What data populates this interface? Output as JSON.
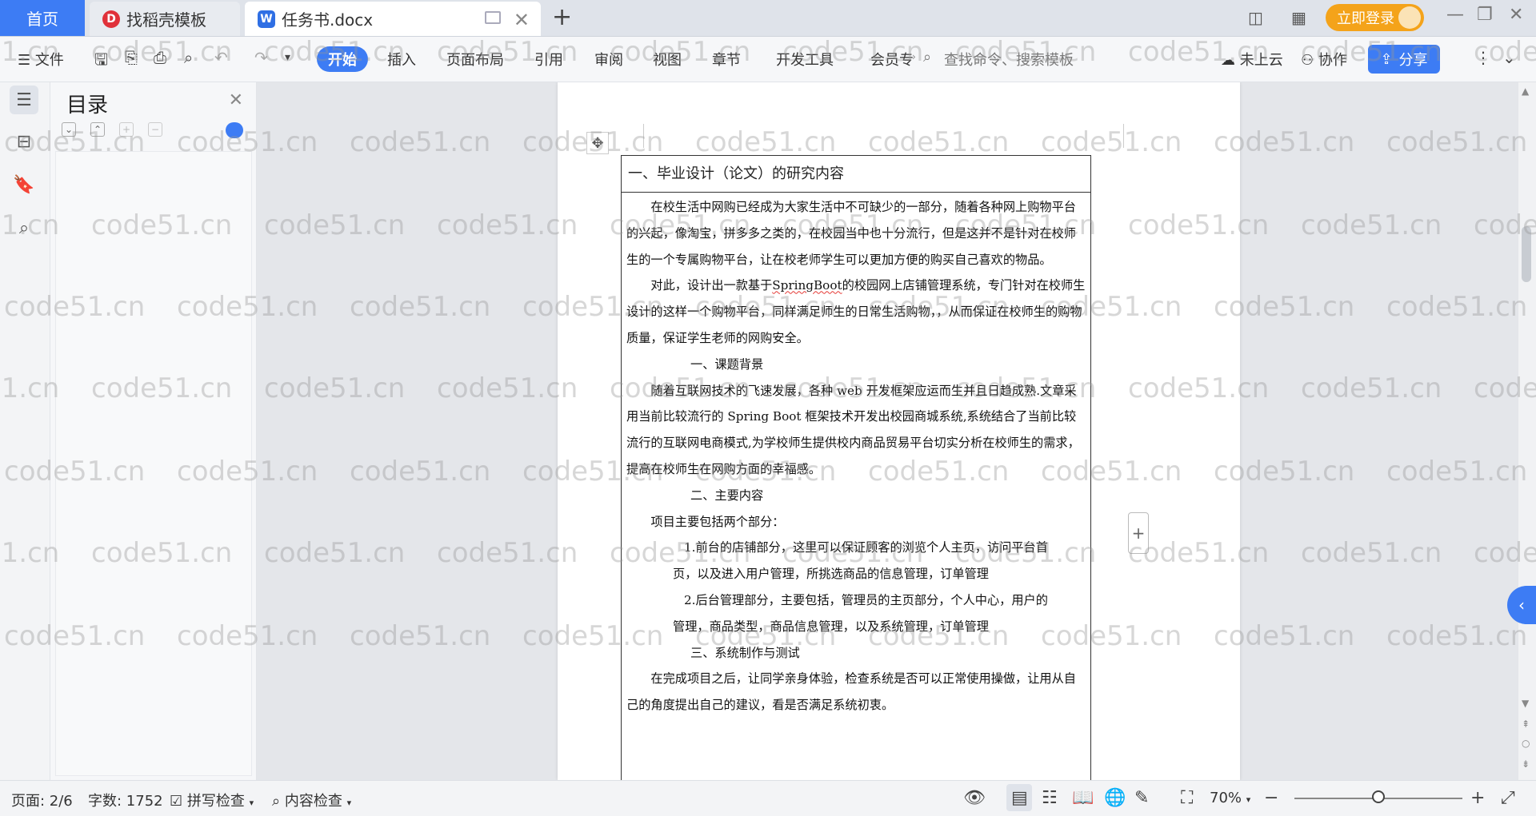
{
  "tabs": {
    "home": "首页",
    "template": "找稻壳模板",
    "document": "任务书.docx",
    "login": "立即登录"
  },
  "ribbon": {
    "file": "文件",
    "items": [
      "开始",
      "插入",
      "页面布局",
      "引用",
      "审阅",
      "视图",
      "章节",
      "开发工具",
      "会员专"
    ],
    "search_placeholder": "查找命令、搜索模板",
    "cloud": "未上云",
    "collab": "协作",
    "share": "分享"
  },
  "nav": {
    "title": "目录"
  },
  "document": {
    "table_heading": "一、毕业设计（论文）的研究内容",
    "paragraphs": {
      "p1": "在校生活中网购已经成为大家生活中不可缺少的一部分，随着各种网上购物平台的兴起，像淘宝，拼多多之类的，在校园当中也十分流行，但是这并不是针对在校师生的一个专属购物平台，让在校老师学生可以更加方便的购买自己喜欢的物品。",
      "p2_before": "对此，设计出一款基于",
      "p2_term": "SpringBoot",
      "p2_after": "的校园网上店铺管理系统，专门针对在校师生设计的这样一个购物平台，同样满足师生的日常生活购物，，从而保证在校师生的购物质量，保证学生老师的网购安全。",
      "h1": "一、课题背景",
      "p3": "随着互联网技术的飞速发展，各种 web 开发框架应运而生并且日趋成熟.文章采用当前比较流行的 Spring Boot 框架技术开发出校园商城系统,系统结合了当前比较流行的互联网电商模式,为学校师生提供校内商品贸易平台切实分析在校师生的需求，提高在校师生在网购方面的幸福感。",
      "h2": "二、主要内容",
      "p4": "项目主要包括两个部分：",
      "li1a": "1.前台的店铺部分，这里可以保证顾客的浏览个人主页，访问平台首",
      "li1b": "页，以及进入用户管理，所挑选商品的信息管理，订单管理",
      "li2a": "2.后台管理部分，主要包括，管理员的主页部分，个人中心，用户的",
      "li2b": "管理，商品类型，商品信息管理，以及系统管理，订单管理",
      "h3": "三、系统制作与测试",
      "p5": "在完成项目之后，让同学亲身体验，检查系统是否可以正常使用操做，让用从自己的角度提出自己的建议，看是否满足系统初衷。"
    }
  },
  "status": {
    "page": "页面: 2/6",
    "words": "字数: 1752",
    "spell": "拼写检查",
    "content": "内容检查",
    "zoom": "70%",
    "zoom_level": 0.5
  },
  "watermark": "code51.cn"
}
